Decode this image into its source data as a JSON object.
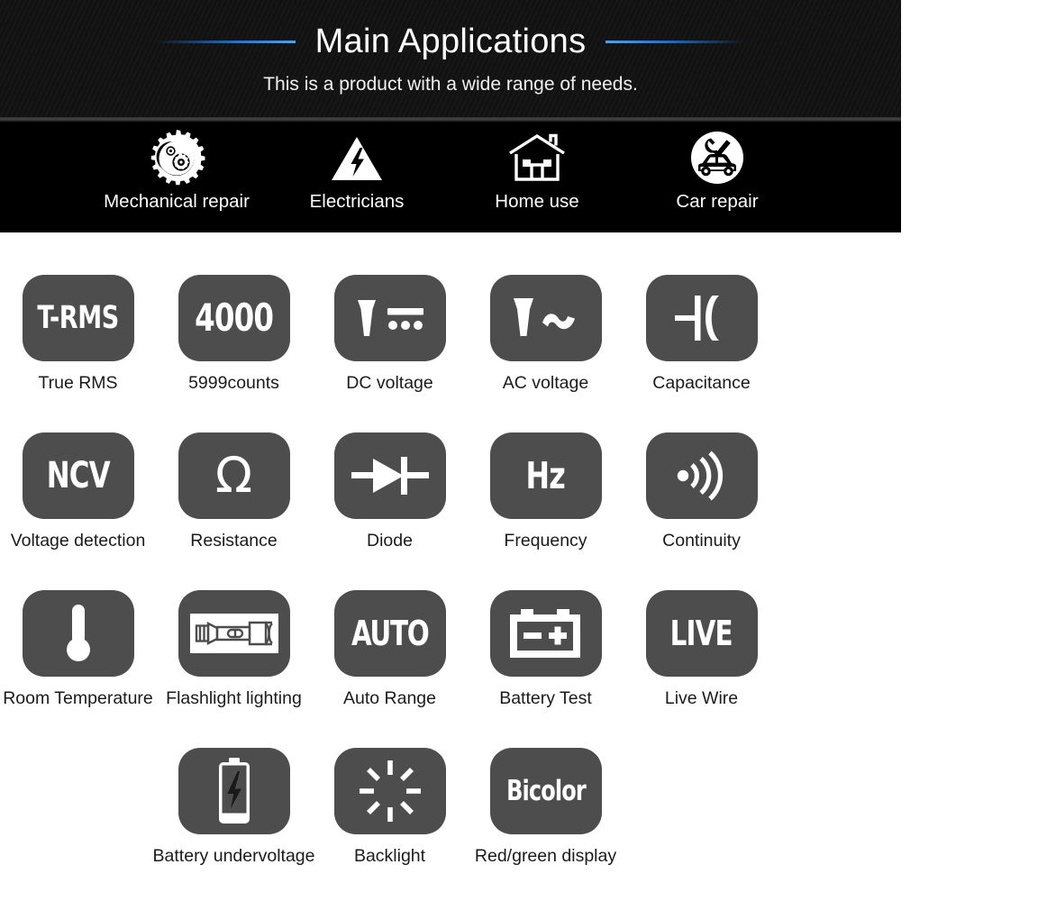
{
  "header": {
    "title": "Main Applications",
    "subtitle": "This is a product with a wide range of needs.",
    "accent_color": "#1b6fd0",
    "background_color": "#000000",
    "applications": [
      {
        "icon": "gears-icon",
        "label": "Mechanical repair"
      },
      {
        "icon": "lightning-triangle-icon",
        "label": "Electricians"
      },
      {
        "icon": "house-icon",
        "label": "Home use"
      },
      {
        "icon": "car-repair-icon",
        "label": "Car repair"
      }
    ]
  },
  "features": {
    "tile_color": "#4d4d4d",
    "label_color": "#1b1b1b",
    "rows": [
      [
        {
          "icon": "t-rms-text-icon",
          "glyph": "T-RMS",
          "label": "True RMS"
        },
        {
          "icon": "counts-text-icon",
          "glyph": "4000",
          "label": "5999counts"
        },
        {
          "icon": "dc-voltage-icon",
          "glyph": "V",
          "label": "DC voltage"
        },
        {
          "icon": "ac-voltage-icon",
          "glyph": "V~",
          "label": "AC voltage"
        },
        {
          "icon": "capacitor-icon",
          "glyph": "",
          "label": "Capacitance"
        }
      ],
      [
        {
          "icon": "ncv-text-icon",
          "glyph": "NCV",
          "label": "Voltage detection"
        },
        {
          "icon": "ohm-icon",
          "glyph": "Ω",
          "label": "Resistance"
        },
        {
          "icon": "diode-icon",
          "glyph": "",
          "label": "Diode"
        },
        {
          "icon": "hertz-text-icon",
          "glyph": "Hz",
          "label": "Frequency"
        },
        {
          "icon": "continuity-wave-icon",
          "glyph": "",
          "label": "Continuity"
        }
      ],
      [
        {
          "icon": "thermometer-icon",
          "glyph": "",
          "label": "Room Temperature"
        },
        {
          "icon": "flashlight-icon",
          "glyph": "",
          "label": "Flashlight lighting"
        },
        {
          "icon": "auto-text-icon",
          "glyph": "AUTO",
          "label": "Auto Range"
        },
        {
          "icon": "car-battery-icon",
          "glyph": "",
          "label": "Battery Test"
        },
        {
          "icon": "live-text-icon",
          "glyph": "LIVE",
          "label": "Live Wire"
        }
      ],
      [
        {
          "icon": "battery-bolt-icon",
          "glyph": "",
          "label": "Battery undervoltage"
        },
        {
          "icon": "backlight-rays-icon",
          "glyph": "",
          "label": "Backlight"
        },
        {
          "icon": "bicolor-text-icon",
          "glyph": "Bicolor",
          "label": "Red/green display"
        }
      ]
    ]
  }
}
